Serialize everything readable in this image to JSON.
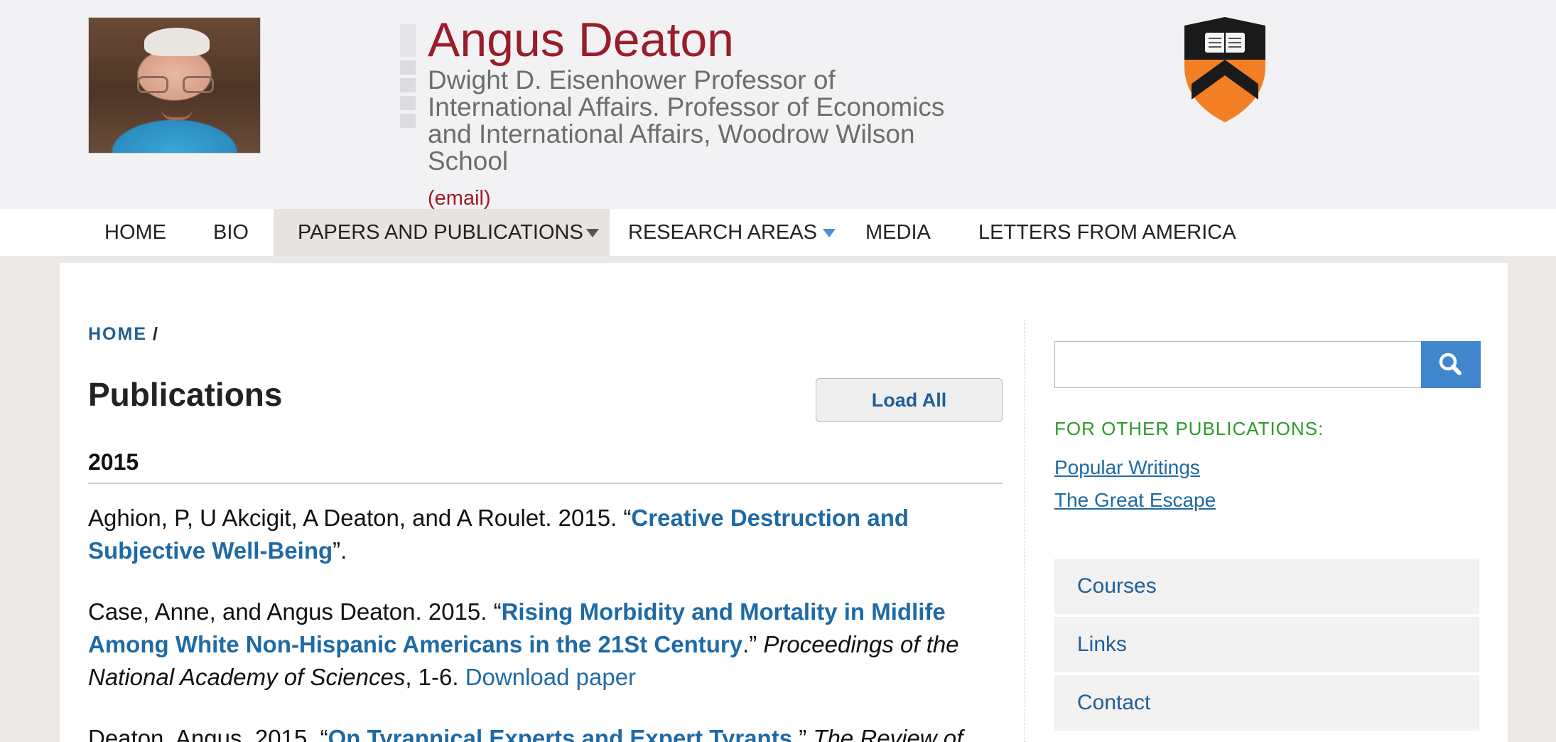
{
  "header": {
    "name": "Angus Deaton",
    "subtitle": "Dwight D. Eisenhower Professor of International Affairs. Professor of Economics and International Affairs, Woodrow Wilson School",
    "email_label": "(email)"
  },
  "nav": {
    "items": [
      {
        "label": "HOME"
      },
      {
        "label": "BIO"
      },
      {
        "label": "PAPERS AND PUBLICATIONS"
      },
      {
        "label": "RESEARCH AREAS"
      },
      {
        "label": "MEDIA"
      },
      {
        "label": "LETTERS FROM AMERICA"
      }
    ]
  },
  "breadcrumb": {
    "home": "HOME",
    "separator": "/"
  },
  "page": {
    "title": "Publications",
    "load_all": "Load All",
    "year": "2015"
  },
  "publications": [
    {
      "prefix": "Aghion, P, U Akcigit, A Deaton, and A Roulet. 2015. “",
      "title": "Creative Destruction and Subjective Well-Being",
      "suffix": "”."
    },
    {
      "prefix": "Case, Anne, and Angus Deaton. 2015. “",
      "title": "Rising Morbidity and Mortality in Midlife Among White Non-Hispanic Americans in the 21St Century",
      "mid": ".” ",
      "journal": "Proceedings of the National Academy of Sciences",
      "pages": ", 1-6. ",
      "download": "Download paper"
    },
    {
      "prefix": "Deaton, Angus. 2015. “",
      "title": "On Tyrannical Experts and Expert Tyrants",
      "mid": ".” ",
      "journal": "The Review of"
    }
  ],
  "sidebar": {
    "search_placeholder": "",
    "other_publications_heading": "FOR OTHER PUBLICATIONS:",
    "links": [
      "Popular Writings",
      "The Great Escape"
    ],
    "menu": [
      "Courses",
      "Links",
      "Contact"
    ]
  },
  "icons": {
    "search": "magnifier-icon",
    "shield": "princeton-shield-icon"
  },
  "colors": {
    "name": "#9b1c2a",
    "link": "#1f6aa5",
    "accent_green": "#2c9a2c",
    "search_button": "#3f86cc"
  }
}
